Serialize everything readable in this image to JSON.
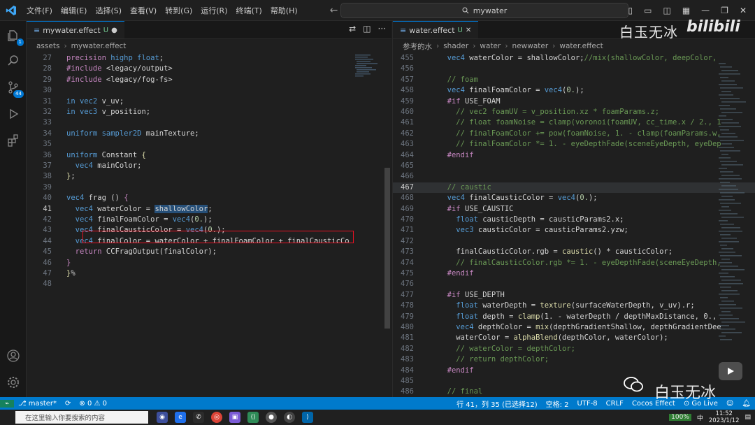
{
  "menu": [
    "文件(F)",
    "编辑(E)",
    "选择(S)",
    "查看(V)",
    "转到(G)",
    "运行(R)",
    "终端(T)",
    "帮助(H)"
  ],
  "command_center": "mywater",
  "activity_badges": {
    "explorer": "1",
    "scm": "44"
  },
  "left": {
    "tab_label": "mywater.effect",
    "tab_status": "U",
    "breadcrumb": [
      "assets",
      "mywater.effect"
    ],
    "lines": [
      {
        "n": "27",
        "parts": [
          [
            "kw2",
            "precision "
          ],
          [
            "kw",
            "highp "
          ],
          [
            "kw",
            "float"
          ],
          [
            "pl",
            ";"
          ]
        ]
      },
      {
        "n": "28",
        "parts": [
          [
            "kw2",
            "#include "
          ],
          [
            "pl",
            "<legacy/output>"
          ]
        ]
      },
      {
        "n": "29",
        "parts": [
          [
            "kw2",
            "#include "
          ],
          [
            "pl",
            "<legacy/fog-fs>"
          ]
        ]
      },
      {
        "n": "30",
        "parts": []
      },
      {
        "n": "31",
        "parts": [
          [
            "kw",
            "in "
          ],
          [
            "kw",
            "vec2 "
          ],
          [
            "pl",
            "v_uv;"
          ]
        ]
      },
      {
        "n": "32",
        "parts": [
          [
            "kw",
            "in "
          ],
          [
            "kw",
            "vec3 "
          ],
          [
            "pl",
            "v_position;"
          ]
        ]
      },
      {
        "n": "33",
        "parts": []
      },
      {
        "n": "34",
        "parts": [
          [
            "kw",
            "uniform "
          ],
          [
            "kw",
            "sampler2D "
          ],
          [
            "pl",
            "mainTexture;"
          ]
        ]
      },
      {
        "n": "35",
        "parts": []
      },
      {
        "n": "36",
        "parts": [
          [
            "kw",
            "uniform "
          ],
          [
            "pl",
            "Constant "
          ],
          [
            "fn",
            "{"
          ]
        ]
      },
      {
        "n": "37",
        "parts": [
          [
            "pl",
            "  "
          ],
          [
            "kw",
            "vec4 "
          ],
          [
            "pl",
            "mainColor;"
          ]
        ]
      },
      {
        "n": "38",
        "parts": [
          [
            "fn",
            "}"
          ],
          [
            "pl",
            ";"
          ]
        ]
      },
      {
        "n": "39",
        "parts": []
      },
      {
        "n": "40",
        "parts": [
          [
            "kw",
            "vec4 "
          ],
          [
            "pl",
            "frag () "
          ],
          [
            "kw2",
            "{"
          ]
        ]
      },
      {
        "n": "41",
        "parts": [
          [
            "pl",
            "  "
          ],
          [
            "kw",
            "vec4 "
          ],
          [
            "pl",
            "waterColor = "
          ],
          [
            "hl",
            "shallowColor"
          ],
          [
            "pl",
            ";"
          ]
        ]
      },
      {
        "n": "42",
        "parts": [
          [
            "pl",
            "  "
          ],
          [
            "kw",
            "vec4 "
          ],
          [
            "pl",
            "finalFoamColor = "
          ],
          [
            "kw",
            "vec4"
          ],
          [
            "pl",
            "("
          ],
          [
            "nm",
            "0."
          ],
          [
            "pl",
            ");"
          ]
        ]
      },
      {
        "n": "43",
        "parts": [
          [
            "pl",
            "  "
          ],
          [
            "kw",
            "vec4 "
          ],
          [
            "pl",
            "finalCausticColor = "
          ],
          [
            "kw",
            "vec4"
          ],
          [
            "pl",
            "("
          ],
          [
            "nm",
            "0."
          ],
          [
            "pl",
            ");"
          ]
        ]
      },
      {
        "n": "44",
        "parts": [
          [
            "pl",
            "  "
          ],
          [
            "kw",
            "vec4 "
          ],
          [
            "pl",
            "finalColor = waterColor + finalFoamColor + finalCausticCo"
          ]
        ]
      },
      {
        "n": "45",
        "parts": [
          [
            "pl",
            "  "
          ],
          [
            "kw2",
            "return "
          ],
          [
            "pl",
            "CCFragOutput(finalColor);"
          ]
        ]
      },
      {
        "n": "46",
        "parts": [
          [
            "kw2",
            "}"
          ]
        ]
      },
      {
        "n": "47",
        "parts": [
          [
            "fn",
            "}"
          ],
          [
            "pl",
            "%"
          ]
        ]
      },
      {
        "n": "48",
        "parts": []
      }
    ]
  },
  "right": {
    "tab_label": "water.effect",
    "tab_status": "U",
    "breadcrumb": [
      "参考的水",
      "shader",
      "water",
      "newwater",
      "water.effect"
    ],
    "lines": [
      {
        "n": "455",
        "parts": [
          [
            "pl",
            "  "
          ],
          [
            "kw",
            "vec4 "
          ],
          [
            "pl",
            "waterColor = shallowColor;"
          ],
          [
            "cm",
            "//mix(shallowColor, deepColor,"
          ]
        ]
      },
      {
        "n": "456",
        "parts": []
      },
      {
        "n": "457",
        "parts": [
          [
            "pl",
            "  "
          ],
          [
            "cm",
            "// foam"
          ]
        ]
      },
      {
        "n": "458",
        "parts": [
          [
            "pl",
            "  "
          ],
          [
            "kw",
            "vec4 "
          ],
          [
            "pl",
            "finalFoamColor = "
          ],
          [
            "kw",
            "vec4"
          ],
          [
            "pl",
            "("
          ],
          [
            "nm",
            "0."
          ],
          [
            "pl",
            ");"
          ]
        ]
      },
      {
        "n": "459",
        "parts": [
          [
            "pl",
            "  "
          ],
          [
            "kw2",
            "#if "
          ],
          [
            "pl",
            "USE_FOAM"
          ]
        ]
      },
      {
        "n": "460",
        "parts": [
          [
            "pl",
            "    "
          ],
          [
            "cm",
            "// vec2 foamUV = v_position.xz * foamParams.z;"
          ]
        ]
      },
      {
        "n": "461",
        "parts": [
          [
            "pl",
            "    "
          ],
          [
            "cm",
            "// float foamNoise = clamp(voronoi(foamUV, cc_time.x / 2., 1"
          ]
        ]
      },
      {
        "n": "462",
        "parts": [
          [
            "pl",
            "    "
          ],
          [
            "cm",
            "// finalFoamColor += pow(foamNoise, 1. - clamp(foamParams.w,"
          ]
        ]
      },
      {
        "n": "463",
        "parts": [
          [
            "pl",
            "    "
          ],
          [
            "cm",
            "// finalFoamColor *= 1. - eyeDepthFade(sceneEyeDepth, eyeDep"
          ]
        ]
      },
      {
        "n": "464",
        "parts": [
          [
            "pl",
            "  "
          ],
          [
            "kw2",
            "#endif"
          ]
        ]
      },
      {
        "n": "465",
        "parts": []
      },
      {
        "n": "466",
        "parts": []
      },
      {
        "n": "467",
        "parts": [
          [
            "pl",
            "  "
          ],
          [
            "cm",
            "// caustic"
          ]
        ]
      },
      {
        "n": "468",
        "parts": [
          [
            "pl",
            "  "
          ],
          [
            "kw",
            "vec4 "
          ],
          [
            "pl",
            "finalCausticColor = "
          ],
          [
            "kw",
            "vec4"
          ],
          [
            "pl",
            "("
          ],
          [
            "nm",
            "0."
          ],
          [
            "pl",
            ");"
          ]
        ]
      },
      {
        "n": "469",
        "parts": [
          [
            "pl",
            "  "
          ],
          [
            "kw2",
            "#if "
          ],
          [
            "pl",
            "USE_CAUSTIC"
          ]
        ]
      },
      {
        "n": "470",
        "parts": [
          [
            "pl",
            "    "
          ],
          [
            "kw",
            "float "
          ],
          [
            "pl",
            "causticDepth = causticParams2.x;"
          ]
        ]
      },
      {
        "n": "471",
        "parts": [
          [
            "pl",
            "    "
          ],
          [
            "kw",
            "vec3 "
          ],
          [
            "pl",
            "causticColor = causticParams2.yzw;"
          ]
        ]
      },
      {
        "n": "472",
        "parts": []
      },
      {
        "n": "473",
        "parts": [
          [
            "pl",
            "    finalCausticColor.rgb = "
          ],
          [
            "fn",
            "caustic"
          ],
          [
            "pl",
            "() * causticColor;"
          ]
        ]
      },
      {
        "n": "474",
        "parts": [
          [
            "pl",
            "    "
          ],
          [
            "cm",
            "// finalCausticColor.rgb *= 1. - eyeDepthFade(sceneEyeDepth,"
          ]
        ]
      },
      {
        "n": "475",
        "parts": [
          [
            "pl",
            "  "
          ],
          [
            "kw2",
            "#endif"
          ]
        ]
      },
      {
        "n": "476",
        "parts": []
      },
      {
        "n": "477",
        "parts": [
          [
            "pl",
            "  "
          ],
          [
            "kw2",
            "#if "
          ],
          [
            "pl",
            "USE_DEPTH"
          ]
        ]
      },
      {
        "n": "478",
        "parts": [
          [
            "pl",
            "    "
          ],
          [
            "kw",
            "float "
          ],
          [
            "pl",
            "waterDepth = "
          ],
          [
            "fn",
            "texture"
          ],
          [
            "pl",
            "(surfaceWaterDepth, v_uv).r;"
          ]
        ]
      },
      {
        "n": "479",
        "parts": [
          [
            "pl",
            "    "
          ],
          [
            "kw",
            "float "
          ],
          [
            "pl",
            "depth = "
          ],
          [
            "fn",
            "clamp"
          ],
          [
            "pl",
            "(1. - waterDepth / depthMaxDistance, 0.,"
          ]
        ]
      },
      {
        "n": "480",
        "parts": [
          [
            "pl",
            "    "
          ],
          [
            "kw",
            "vec4 "
          ],
          [
            "pl",
            "depthColor = "
          ],
          [
            "fn",
            "mix"
          ],
          [
            "pl",
            "(depthGradientShallow, depthGradientDee"
          ]
        ]
      },
      {
        "n": "481",
        "parts": [
          [
            "pl",
            "    waterColor = "
          ],
          [
            "fn",
            "alphaBlend"
          ],
          [
            "pl",
            "(depthColor, waterColor);"
          ]
        ]
      },
      {
        "n": "482",
        "parts": [
          [
            "pl",
            "    "
          ],
          [
            "cm",
            "// waterColor = depthColor;"
          ]
        ]
      },
      {
        "n": "483",
        "parts": [
          [
            "pl",
            "    "
          ],
          [
            "cm",
            "// return depthColor;"
          ]
        ]
      },
      {
        "n": "484",
        "parts": [
          [
            "pl",
            "  "
          ],
          [
            "kw2",
            "#endif"
          ]
        ]
      },
      {
        "n": "485",
        "parts": []
      },
      {
        "n": "486",
        "parts": [
          [
            "pl",
            "  "
          ],
          [
            "cm",
            "// final"
          ]
        ]
      }
    ]
  },
  "status": {
    "branch": "master*",
    "errors": "0",
    "warnings": "0",
    "position": "行 41，列 35 (已选择12)",
    "spaces": "空格: 2",
    "encoding": "UTF-8",
    "eol": "CRLF",
    "language": "Cocos Effect",
    "golive": "Go Live"
  },
  "taskbar": {
    "search_placeholder": "在这里输入你要搜索的内容",
    "battery": "100%",
    "ime": "中",
    "time": "11:52",
    "date": "2023/1/12"
  },
  "watermark": {
    "top_text": "白玉无冰",
    "top_brand": "bilibili",
    "bottom_text": "白玉无冰"
  }
}
